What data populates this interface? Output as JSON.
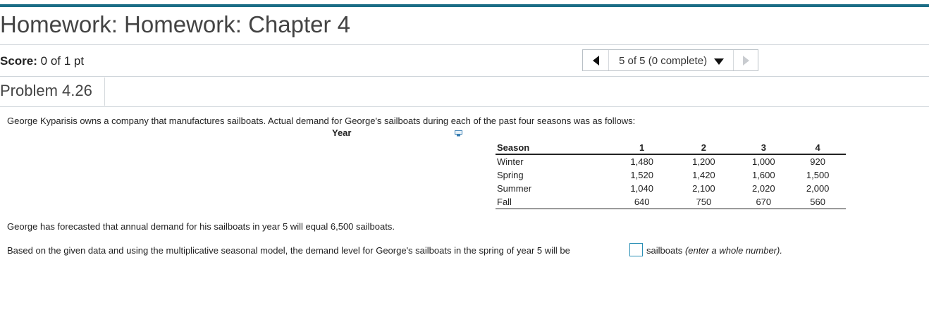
{
  "header": {
    "title": "Homework: Homework: Chapter 4"
  },
  "score": {
    "label": "Score:",
    "value": "0 of 1 pt"
  },
  "navigation": {
    "prev_icon": "triangle-left-icon",
    "label": "5 of 5 (0 complete)",
    "dropdown_icon": "triangle-down-icon",
    "next_icon": "triangle-right-icon"
  },
  "problem": {
    "title": "Problem 4.26"
  },
  "content": {
    "intro": "George Kyparisis owns a company that manufactures sailboats.  Actual demand for George's sailboats during each of the past four seasons was as follows:",
    "year_label": "Year",
    "copy_icon": "copy-to-clipboard-icon",
    "table": {
      "headers": [
        "Season",
        "1",
        "2",
        "3",
        "4"
      ],
      "rows": [
        [
          "Winter",
          "1,480",
          "1,200",
          "1,000",
          "920"
        ],
        [
          "Spring",
          "1,520",
          "1,420",
          "1,600",
          "1,500"
        ],
        [
          "Summer",
          "1,040",
          "2,100",
          "2,020",
          "2,000"
        ],
        [
          "Fall",
          "640",
          "750",
          "670",
          "560"
        ]
      ]
    },
    "forecast_text": "George has forecasted that annual demand for his sailboats in year 5 will equal 6,500 sailboats.",
    "question_before": "Based on the given data and using the multiplicative seasonal model, the demand level for George's sailboats in the spring of year 5 will be",
    "answer_value": "",
    "question_after": "sailboats",
    "question_hint": "(enter a whole number)."
  },
  "colors": {
    "accent_bar": "#1b6d86",
    "input_border": "#2a8fb5"
  }
}
